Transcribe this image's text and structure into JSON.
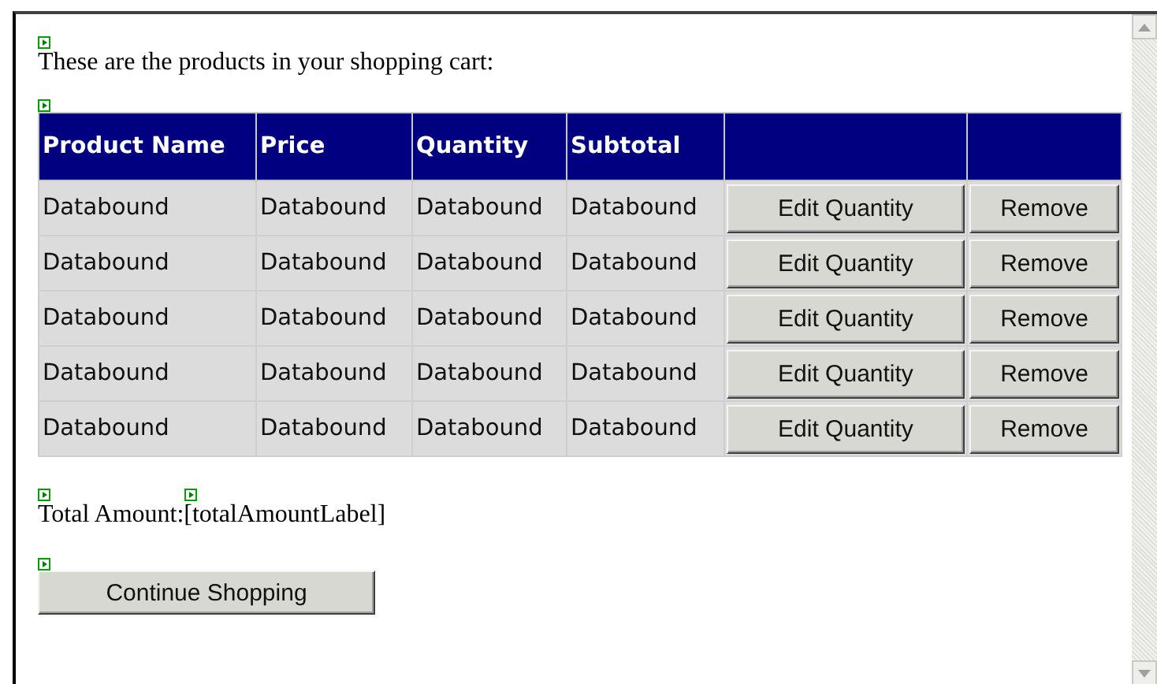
{
  "intro": "These are the products in your shopping cart:",
  "table": {
    "columns": [
      "Product Name",
      "Price",
      "Quantity",
      "Subtotal"
    ],
    "rows": [
      {
        "cells": [
          "Databound",
          "Databound",
          "Databound",
          "Databound"
        ],
        "buttons": [
          "Edit Quantity",
          "Remove"
        ]
      },
      {
        "cells": [
          "Databound",
          "Databound",
          "Databound",
          "Databound"
        ],
        "buttons": [
          "Edit Quantity",
          "Remove"
        ]
      },
      {
        "cells": [
          "Databound",
          "Databound",
          "Databound",
          "Databound"
        ],
        "buttons": [
          "Edit Quantity",
          "Remove"
        ]
      },
      {
        "cells": [
          "Databound",
          "Databound",
          "Databound",
          "Databound"
        ],
        "buttons": [
          "Edit Quantity",
          "Remove"
        ]
      },
      {
        "cells": [
          "Databound",
          "Databound",
          "Databound",
          "Databound"
        ],
        "buttons": [
          "Edit Quantity",
          "Remove"
        ]
      }
    ]
  },
  "total": {
    "label": "Total Amount:",
    "value": "[totalAmountLabel]"
  },
  "continue_button": "Continue Shopping"
}
